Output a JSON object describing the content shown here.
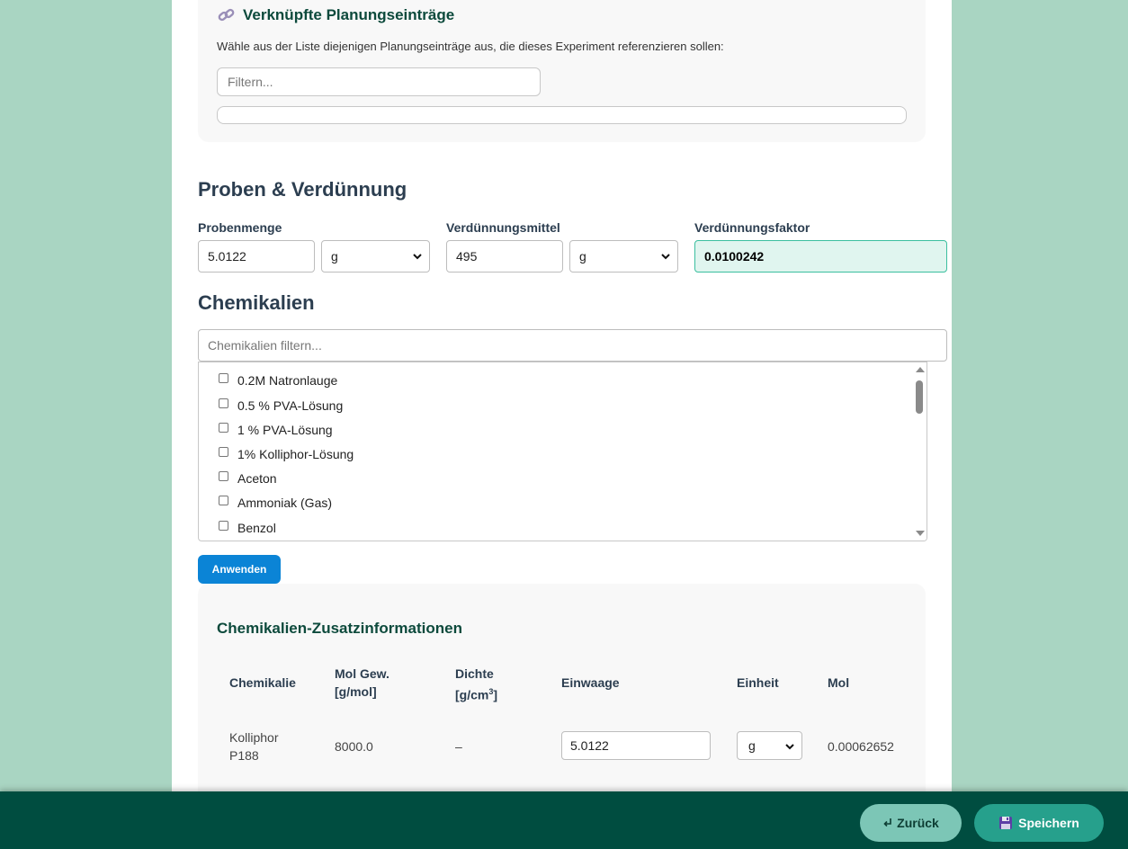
{
  "linked_planning": {
    "title": "Verknüpfte Planungseinträge",
    "icon": "link-icon",
    "description": "Wähle aus der Liste diejenigen Planungseinträge aus, die dieses Experiment referenzieren sollen:",
    "filter_placeholder": "Filtern..."
  },
  "samples": {
    "heading": "Proben & Verdünnung",
    "sample_amount_label": "Probenmenge",
    "sample_amount_value": "5.0122",
    "sample_unit": "g",
    "diluent_label": "Verdünnungsmittel",
    "diluent_value": "495",
    "diluent_unit": "g",
    "factor_label": "Verdünnungsfaktor",
    "factor_value": "0.0100242"
  },
  "chemicals": {
    "heading": "Chemikalien",
    "filter_placeholder": "Chemikalien filtern...",
    "items": [
      "0.2M Natronlauge",
      "0.5 % PVA-Lösung",
      "1 % PVA-Lösung",
      "1% Kolliphor-Lösung",
      "Aceton",
      "Ammoniak (Gas)",
      "Benzol"
    ],
    "apply_label": "Anwenden"
  },
  "chem_info": {
    "title": "Chemikalien-Zusatzinformationen",
    "headers": {
      "chemical": "Chemikalie",
      "mol_weight_1": "Mol Gew.",
      "mol_weight_2": "[g/mol]",
      "density_1": "Dichte",
      "density_2": "[g/cm",
      "density_sup": "3",
      "density_end": "]",
      "weight": "Einwaage",
      "unit": "Einheit",
      "mol": "Mol"
    },
    "row": {
      "chemical_1": "Kolliphor",
      "chemical_2": "P188",
      "mol_weight": "8000.0",
      "density": "–",
      "weight": "5.0122",
      "unit": "g",
      "mol": "0.00062652"
    }
  },
  "footer": {
    "back_label": "Zurück",
    "save_label": "Speichern"
  }
}
